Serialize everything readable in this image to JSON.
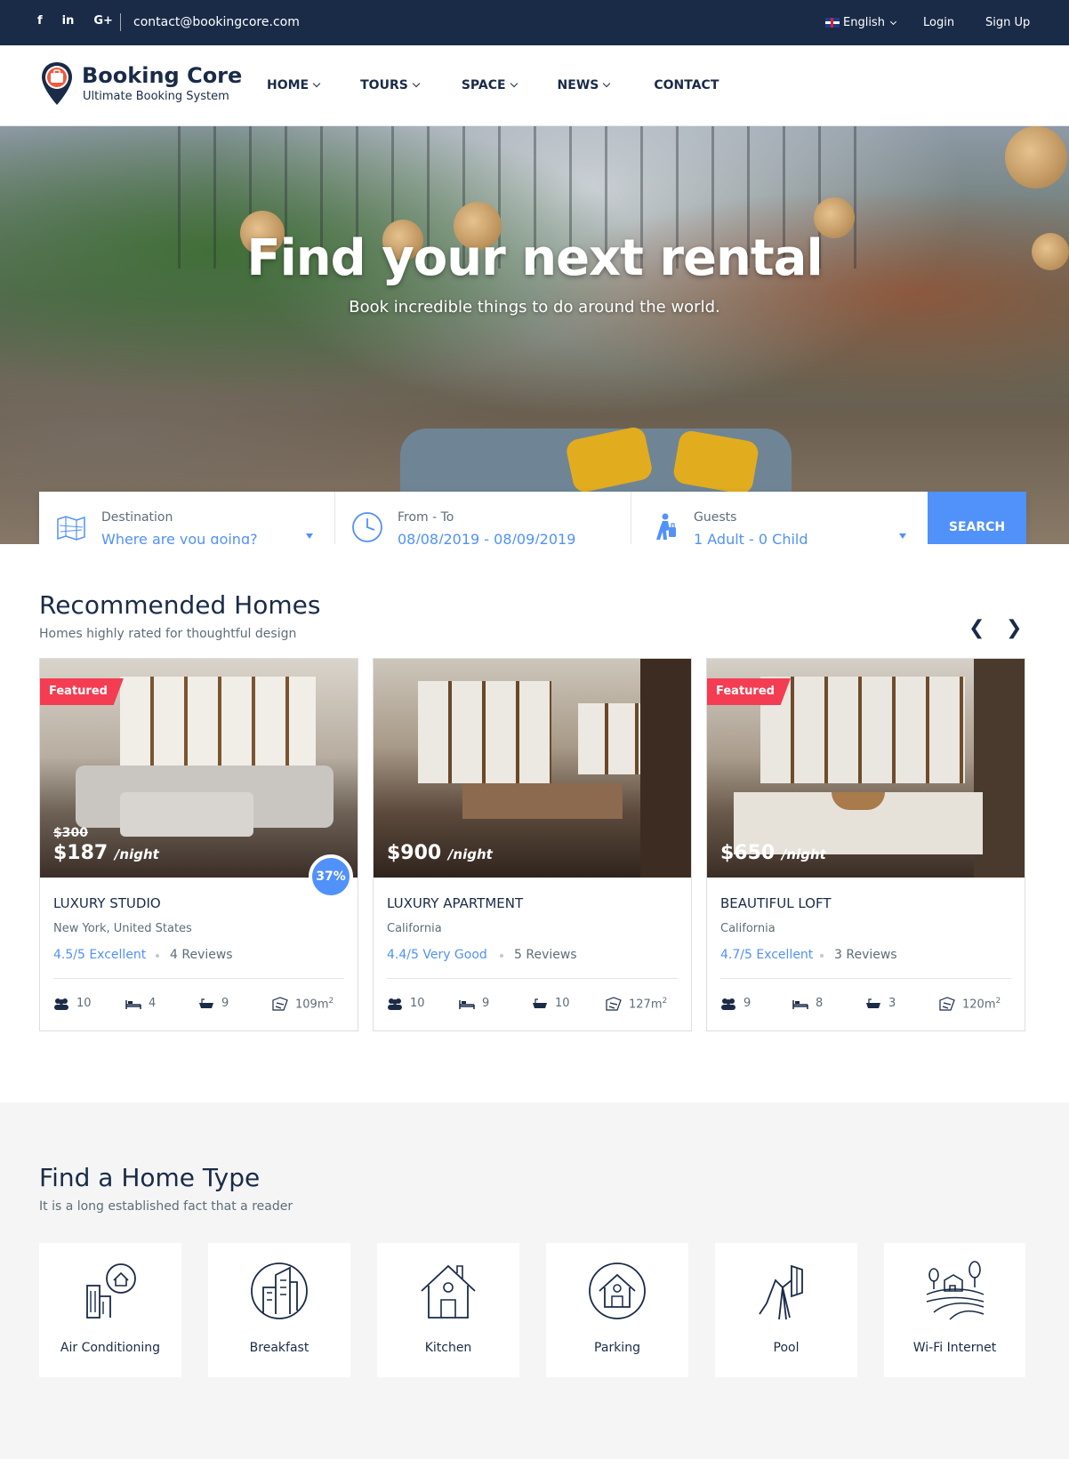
{
  "topbar": {
    "social": [
      "f",
      "in",
      "G+"
    ],
    "email": "contact@bookingcore.com",
    "language": "English",
    "login": "Login",
    "signup": "Sign Up"
  },
  "header": {
    "logo_title": "Booking Core",
    "logo_subtitle": "Ultimate Booking System",
    "nav": [
      {
        "label": "HOME",
        "dropdown": true
      },
      {
        "label": "TOURS",
        "dropdown": true
      },
      {
        "label": "SPACE",
        "dropdown": true
      },
      {
        "label": "NEWS",
        "dropdown": true
      },
      {
        "label": "CONTACT",
        "dropdown": false
      }
    ]
  },
  "hero": {
    "title": "Find your next rental",
    "subtitle": "Book incredible things to do around the world."
  },
  "search": {
    "destination_label": "Destination",
    "destination_value": "Where are you going?",
    "dates_label": "From - To",
    "dates_value": "08/08/2019 - 08/09/2019",
    "guests_label": "Guests",
    "guests_value": "1 Adult - 0 Child",
    "button": "SEARCH"
  },
  "recommended": {
    "title": "Recommended Homes",
    "subtitle": "Homes highly rated for thoughtful design",
    "prev": "❮",
    "next": "❯",
    "cards": [
      {
        "featured": "Featured",
        "old_price": "$300",
        "price": "$187",
        "unit": "/night",
        "discount": "37%",
        "name": "LUXURY STUDIO",
        "location": "New York, United States",
        "rating": "4.5/5 Excellent",
        "reviews": "4 Reviews",
        "guests": "10",
        "beds": "4",
        "baths": "9",
        "area": "109m",
        "area_sup": "2"
      },
      {
        "featured": "",
        "old_price": "",
        "price": "$900",
        "unit": "/night",
        "discount": "",
        "name": "LUXURY APARTMENT",
        "location": "California",
        "rating": "4.4/5 Very Good",
        "reviews": "5 Reviews",
        "guests": "10",
        "beds": "9",
        "baths": "10",
        "area": "127m",
        "area_sup": "2"
      },
      {
        "featured": "Featured",
        "old_price": "",
        "price": "$650",
        "unit": "/night",
        "discount": "",
        "name": "BEAUTIFUL LOFT",
        "location": "California",
        "rating": "4.7/5 Excellent",
        "reviews": "3 Reviews",
        "guests": "9",
        "beds": "8",
        "baths": "3",
        "area": "120m",
        "area_sup": "2"
      }
    ]
  },
  "home_types": {
    "title": "Find a Home Type",
    "subtitle": "It is a long established fact that a reader",
    "items": [
      {
        "label": "Air Conditioning",
        "icon": "city-home-icon"
      },
      {
        "label": "Breakfast",
        "icon": "building-circle-icon"
      },
      {
        "label": "Kitchen",
        "icon": "house-icon"
      },
      {
        "label": "Parking",
        "icon": "house-circle-icon"
      },
      {
        "label": "Pool",
        "icon": "lamp-icon"
      },
      {
        "label": "Wi-Fi Internet",
        "icon": "farm-icon"
      }
    ]
  },
  "colors": {
    "navy": "#1a2b48",
    "accent": "#5191fa",
    "featured": "#f43d52"
  }
}
